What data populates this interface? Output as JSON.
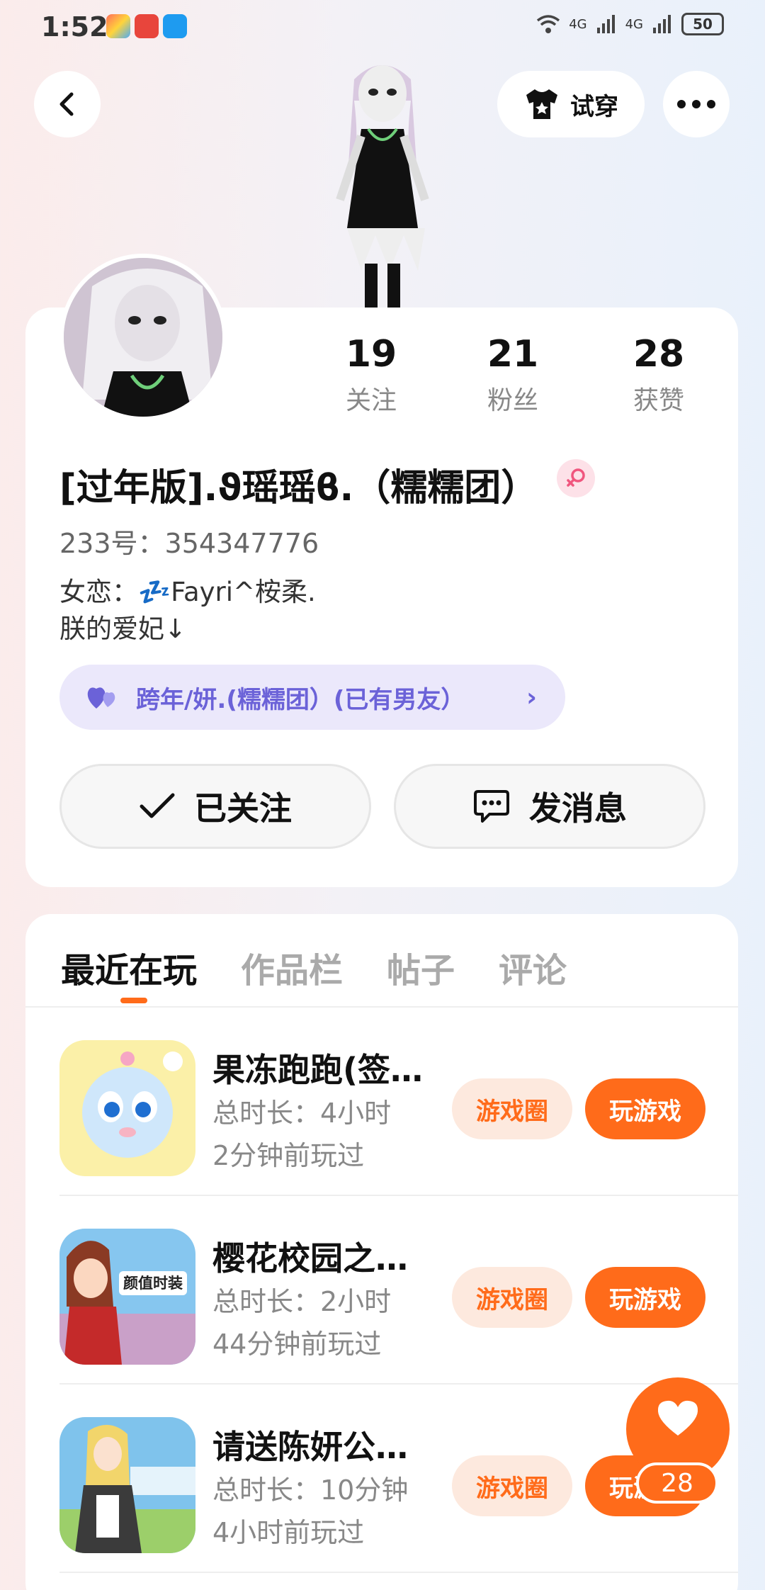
{
  "status_bar": {
    "time": "1:52",
    "signal1": "4G",
    "signal2": "4G",
    "battery": "50"
  },
  "header": {
    "tryon_label": "试穿"
  },
  "stats": [
    {
      "num": "19",
      "label": "关注"
    },
    {
      "num": "21",
      "label": "粉丝"
    },
    {
      "num": "28",
      "label": "获赞"
    }
  ],
  "profile": {
    "nickname": "[过年版].ϑ瑶瑶ϐ.（糯糯团）",
    "uid": "233号：354347776",
    "bio_line1": "女恋：💤Fayri^桉柔.",
    "bio_line2": "朕的爱妃↓",
    "couple_text": "跨年/妍.(糯糯团）(已有男友）"
  },
  "actions": {
    "follow_label": "已关注",
    "message_label": "发消息"
  },
  "tabs": [
    "最近在玩",
    "作品栏",
    "帖子",
    "评论"
  ],
  "games": [
    {
      "title": "果冻跑跑(签…",
      "duration": "总时长：4小时",
      "last": "2分钟前玩过",
      "circle": "游戏圈",
      "play": "玩游戏"
    },
    {
      "title": "樱花校园之…",
      "duration": "总时长：2小时",
      "last": "44分钟前玩过",
      "circle": "游戏圈",
      "play": "玩游戏"
    },
    {
      "title": "请送陈妍公…",
      "duration": "总时长：10分钟",
      "last": "4小时前玩过",
      "circle": "游戏圈",
      "play": "玩游戏"
    }
  ],
  "game_icon_text": "颜值时装",
  "like": {
    "count": "28"
  },
  "colors": {
    "accent": "#ff6b1a",
    "couple_purple": "#6b62d8"
  }
}
